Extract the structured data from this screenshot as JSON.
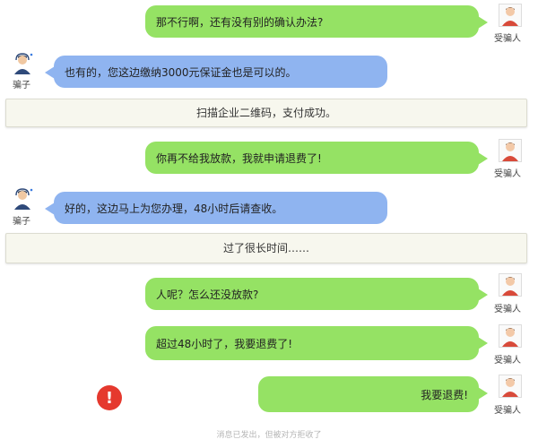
{
  "messages": {
    "m1": "那不行啊，还有没有别的确认办法?",
    "m2": "也有的，您这边缴纳3000元保证金也是可以的。",
    "m3": "你再不给我放款，我就申请退费了!",
    "m4": "好的，这边马上为您办理，48小时后请查收。",
    "m5": "人呢？怎么还没放款?",
    "m6": "超过48小时了，我要退费了!",
    "m7": "我要退费!"
  },
  "notices": {
    "n1": "扫描企业二维码，支付成功。",
    "n2": "过了很长时间……"
  },
  "roles": {
    "victim": "受骗人",
    "scammer": "骗子"
  },
  "error": {
    "symbol": "!",
    "status_text": "消息已发出，但被对方拒收了"
  },
  "icons": {
    "victim_avatar": "person-avatar-icon",
    "scammer_avatar": "headset-agent-avatar-icon",
    "error": "exclamation-circle-icon"
  },
  "colors": {
    "victim_bubble": "#95e264",
    "scammer_bubble": "#8fb4f0",
    "error": "#e5392e"
  }
}
